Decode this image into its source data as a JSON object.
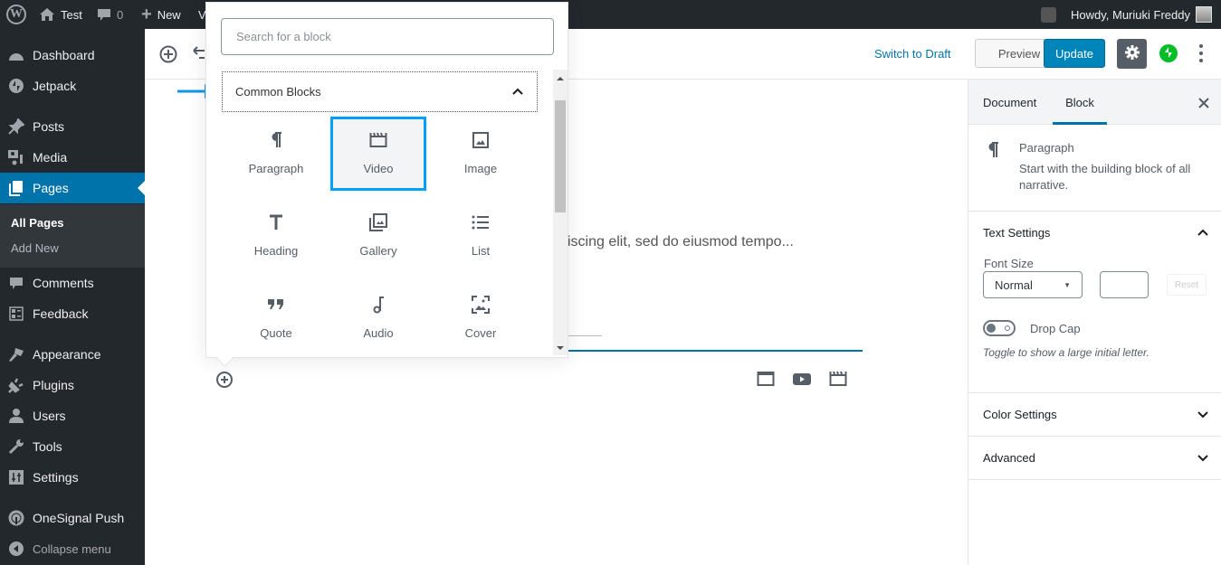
{
  "admin_bar": {
    "site_name": "Test",
    "comments_count": "0",
    "new_label": "New",
    "view_label_partial": "V",
    "greeting": "Howdy, Muriuki Freddy"
  },
  "sidebar": {
    "items": [
      {
        "label": "Dashboard",
        "icon": "dashboard-icon"
      },
      {
        "label": "Jetpack",
        "icon": "jetpack-icon"
      },
      {
        "label": "Posts",
        "icon": "pin-icon"
      },
      {
        "label": "Media",
        "icon": "media-icon"
      },
      {
        "label": "Pages",
        "icon": "pages-icon",
        "current": true
      },
      {
        "label": "Comments",
        "icon": "comment-icon"
      },
      {
        "label": "Feedback",
        "icon": "feedback-icon"
      },
      {
        "label": "Appearance",
        "icon": "brush-icon"
      },
      {
        "label": "Plugins",
        "icon": "plugin-icon"
      },
      {
        "label": "Users",
        "icon": "user-icon"
      },
      {
        "label": "Tools",
        "icon": "wrench-icon"
      },
      {
        "label": "Settings",
        "icon": "settings-icon"
      },
      {
        "label": "OneSignal Push",
        "icon": "onesignal-icon"
      },
      {
        "label": "Collapse menu",
        "icon": "collapse-icon"
      }
    ],
    "submenu": [
      {
        "label": "All Pages",
        "current": true
      },
      {
        "label": "Add New"
      }
    ]
  },
  "header": {
    "switch_to_draft": "Switch to Draft",
    "preview": "Preview",
    "update": "Update"
  },
  "inserter": {
    "search_placeholder": "Search for a block",
    "panel_title": "Common Blocks",
    "blocks": [
      {
        "label": "Paragraph",
        "icon": "paragraph-icon"
      },
      {
        "label": "Video",
        "icon": "video-icon",
        "selected": true
      },
      {
        "label": "Image",
        "icon": "image-icon"
      },
      {
        "label": "Heading",
        "icon": "heading-icon"
      },
      {
        "label": "Gallery",
        "icon": "gallery-icon"
      },
      {
        "label": "List",
        "icon": "list-icon"
      },
      {
        "label": "Quote",
        "icon": "quote-icon"
      },
      {
        "label": "Audio",
        "icon": "audio-icon"
      },
      {
        "label": "Cover",
        "icon": "cover-icon"
      }
    ]
  },
  "content": {
    "paragraph_visible": "iscing elit, sed do eiusmod tempo..."
  },
  "settings_sidebar": {
    "tabs": [
      {
        "label": "Document"
      },
      {
        "label": "Block",
        "active": true
      }
    ],
    "block_card": {
      "title": "Paragraph",
      "description": "Start with the building block of all narrative."
    },
    "text_settings": {
      "title": "Text Settings",
      "font_size_label": "Font Size",
      "font_size_value": "Normal",
      "custom_size_value": "",
      "reset_label": "Reset",
      "drop_cap_label": "Drop Cap",
      "drop_cap_enabled": false,
      "drop_cap_help": "Toggle to show a large initial letter."
    },
    "color_settings_title": "Color Settings",
    "advanced_title": "Advanced"
  },
  "colors": {
    "accent": "#0073aa",
    "update_button": "#0085ba",
    "selection_highlight": "#00a0ff",
    "jetpack": "#00be28",
    "admin_bg": "#23282d"
  }
}
